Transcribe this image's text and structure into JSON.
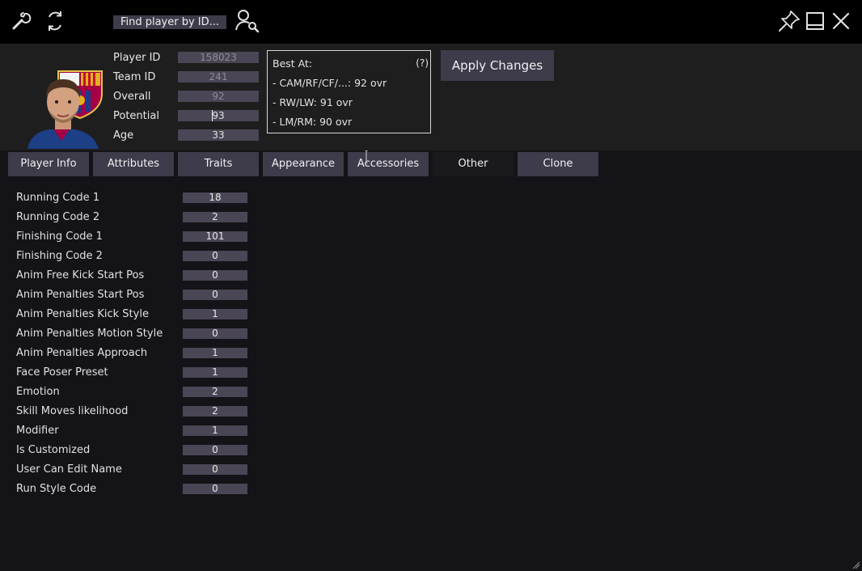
{
  "toolbar": {
    "settings_icon": "wrench-icon",
    "refresh_icon": "refresh-icon",
    "find_label": "Find player by ID...",
    "find_icon": "user-search-icon",
    "pin_icon": "pin-icon",
    "minimize_icon": "minimize-icon",
    "close_icon": "close-icon"
  },
  "player": {
    "portrait": "player-portrait-with-club-crest",
    "fields": [
      {
        "label": "Player ID",
        "value": "158023"
      },
      {
        "label": "Team ID",
        "value": "241"
      },
      {
        "label": "Overall",
        "value": "92"
      },
      {
        "label": "Potential",
        "value": "93"
      },
      {
        "label": "Age",
        "value": "33"
      }
    ]
  },
  "best_at": {
    "title": "Best At:",
    "help": "(?)",
    "lines": [
      "- CAM/RF/CF/...: 92 ovr",
      "- RW/LW: 91 ovr",
      "- LM/RM: 90 ovr"
    ]
  },
  "apply_label": "Apply Changes",
  "tabs": [
    "Player Info",
    "Attributes",
    "Traits",
    "Appearance",
    "Accessories",
    "Other",
    "Clone"
  ],
  "active_tab": "Other",
  "rows": [
    {
      "label": "Running Code 1",
      "value": "18"
    },
    {
      "label": "Running Code 2",
      "value": "2"
    },
    {
      "label": "Finishing Code 1",
      "value": "101"
    },
    {
      "label": "Finishing Code 2",
      "value": "0"
    },
    {
      "label": "Anim Free Kick Start Pos",
      "value": "0"
    },
    {
      "label": "Anim Penalties Start Pos",
      "value": "0"
    },
    {
      "label": "Anim Penalties Kick Style",
      "value": "1"
    },
    {
      "label": "Anim Penalties Motion Style",
      "value": "0"
    },
    {
      "label": "Anim Penalties Approach",
      "value": "1"
    },
    {
      "label": "Face Poser Preset",
      "value": "1"
    },
    {
      "label": "Emotion",
      "value": "2"
    },
    {
      "label": "Skill Moves likelihood",
      "value": "2"
    },
    {
      "label": "Modifier",
      "value": "1"
    },
    {
      "label": "Is Customized",
      "value": "0"
    },
    {
      "label": "User Can Edit Name",
      "value": "0"
    },
    {
      "label": "Run Style Code",
      "value": "0"
    }
  ]
}
